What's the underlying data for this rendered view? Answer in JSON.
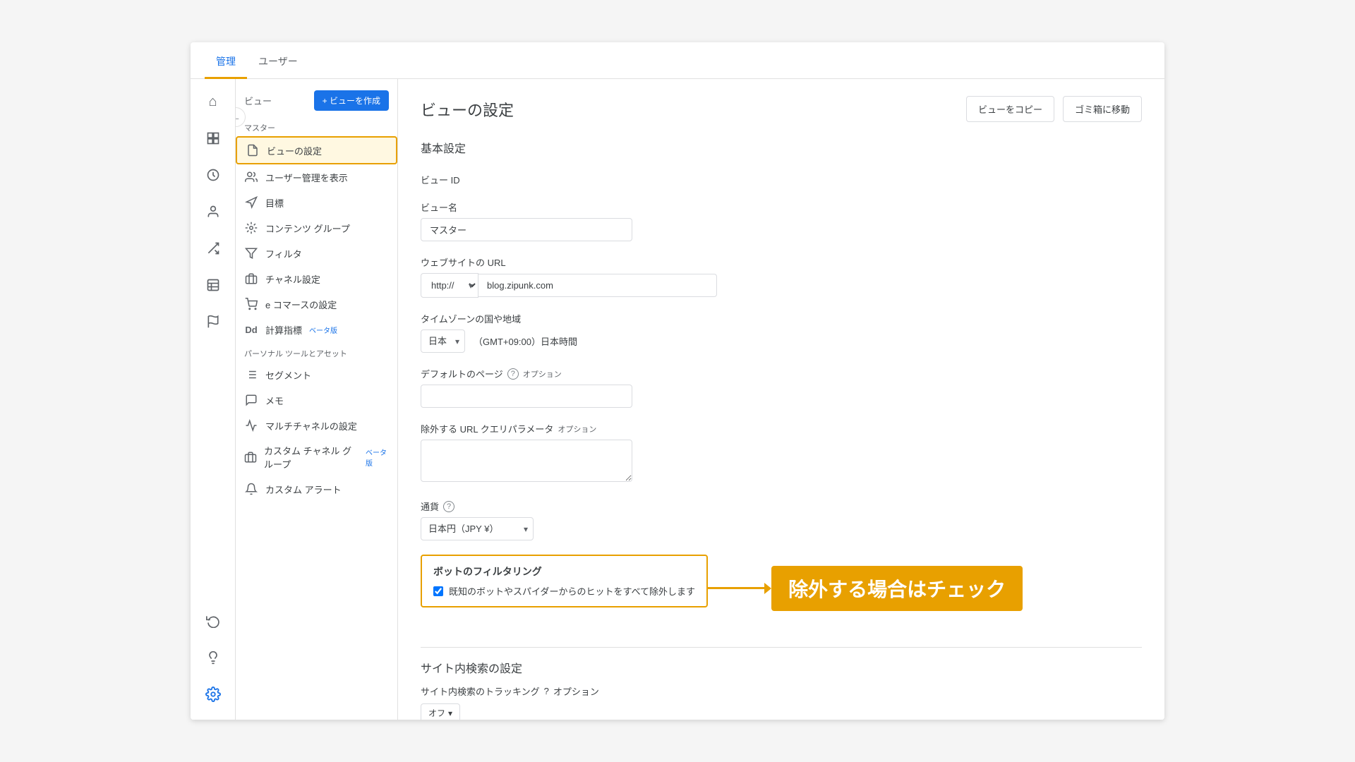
{
  "topNav": {
    "tabs": [
      {
        "label": "管理",
        "active": true
      },
      {
        "label": "ユーザー",
        "active": false
      }
    ]
  },
  "iconSidebar": {
    "items": [
      {
        "name": "home-icon",
        "symbol": "⌂",
        "active": false
      },
      {
        "name": "reports-icon",
        "symbol": "▦",
        "active": false
      },
      {
        "name": "clock-icon",
        "symbol": "◷",
        "active": false
      },
      {
        "name": "users-icon",
        "symbol": "👤",
        "active": false
      },
      {
        "name": "settings-icon-2",
        "symbol": "✦",
        "active": false
      },
      {
        "name": "table-icon",
        "symbol": "▤",
        "active": false
      },
      {
        "name": "flag-icon",
        "symbol": "⚑",
        "active": false
      }
    ],
    "bottomItems": [
      {
        "name": "undo-icon",
        "symbol": "↺"
      },
      {
        "name": "bulb-icon",
        "symbol": "💡"
      },
      {
        "name": "gear-icon",
        "symbol": "⚙",
        "active": true
      }
    ]
  },
  "leftPanel": {
    "sectionLabel": "ビュー",
    "createButton": "+ ビューを作成",
    "masterLabel": "マスター",
    "menuItems": [
      {
        "label": "ビューの設定",
        "icon": "document-icon",
        "active": true
      },
      {
        "label": "ユーザー管理を表示",
        "icon": "users2-icon",
        "active": false
      },
      {
        "label": "目標",
        "icon": "goal-icon",
        "active": false
      },
      {
        "label": "コンテンツ グループ",
        "icon": "content-icon",
        "active": false
      },
      {
        "label": "フィルタ",
        "icon": "filter-icon",
        "active": false
      },
      {
        "label": "チャネル設定",
        "icon": "channel-icon",
        "active": false
      },
      {
        "label": "e コマースの設定",
        "icon": "cart-icon",
        "active": false
      },
      {
        "label": "計算指標",
        "icon": "calc-icon",
        "active": false,
        "beta": "ベータ版"
      }
    ],
    "personalSection": "パーソナル ツールとアセット",
    "personalItems": [
      {
        "label": "セグメント",
        "icon": "segment-icon"
      },
      {
        "label": "メモ",
        "icon": "memo-icon"
      },
      {
        "label": "マルチチャネルの設定",
        "icon": "multichannel-icon"
      },
      {
        "label": "カスタム チャネル グループ",
        "icon": "custom-channel-icon",
        "beta": "ベータ版"
      },
      {
        "label": "カスタム アラート",
        "icon": "alert-icon"
      }
    ]
  },
  "content": {
    "title": "ビューの設定",
    "copyButton": "ビューをコピー",
    "trashButton": "ゴミ箱に移動",
    "basicSettingsLabel": "基本設定",
    "viewIdLabel": "ビュー ID",
    "viewNameLabel": "ビュー名",
    "viewNameValue": "マスター",
    "websiteUrlLabel": "ウェブサイトの URL",
    "urlProtocol": "http://",
    "urlValue": "blog.zipunk.com",
    "timezoneLabel": "タイムゾーンの国や地域",
    "timezoneCountry": "日本",
    "timezoneValue": "（GMT+09:00）日本時間",
    "defaultPageLabel": "デフォルトのページ",
    "defaultPageOptional": "オプション",
    "excludeUrlLabel": "除外する URL クエリパラメータ",
    "excludeUrlOptional": "オプション",
    "currencyLabel": "通貨",
    "currencyValue": "日本円（JPY ¥）",
    "botFilteringTitle": "ボットのフィルタリング",
    "botFilteringCheckbox": "既知のボットやスパイダーからのヒットをすべて除外します",
    "annotationText": "除外する場合はチェック",
    "siteSearchTitle": "サイト内検索の設定",
    "siteSearchTrackingLabel": "サイト内検索のトラッキング",
    "siteSearchTrackingOptional": "オプション",
    "siteSearchToggle": "オフ"
  }
}
